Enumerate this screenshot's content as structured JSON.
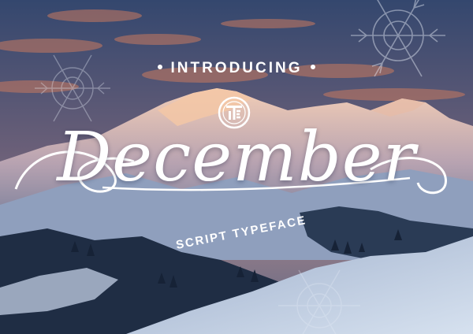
{
  "poster": {
    "intro_text": "INTRODUCING",
    "title": "December",
    "subtitle": "SCRIPT TYPEFACE"
  },
  "icons": {
    "logo": "tk-monogram-icon",
    "decor": "snowflake-icon"
  },
  "colors": {
    "sky_top": "#3a4e78",
    "sky_glow": "#c9795e",
    "mountain_light": "#e8c7b8",
    "snow": "#dfe7f2",
    "forest": "#1c2a3e",
    "text": "#ffffff"
  }
}
